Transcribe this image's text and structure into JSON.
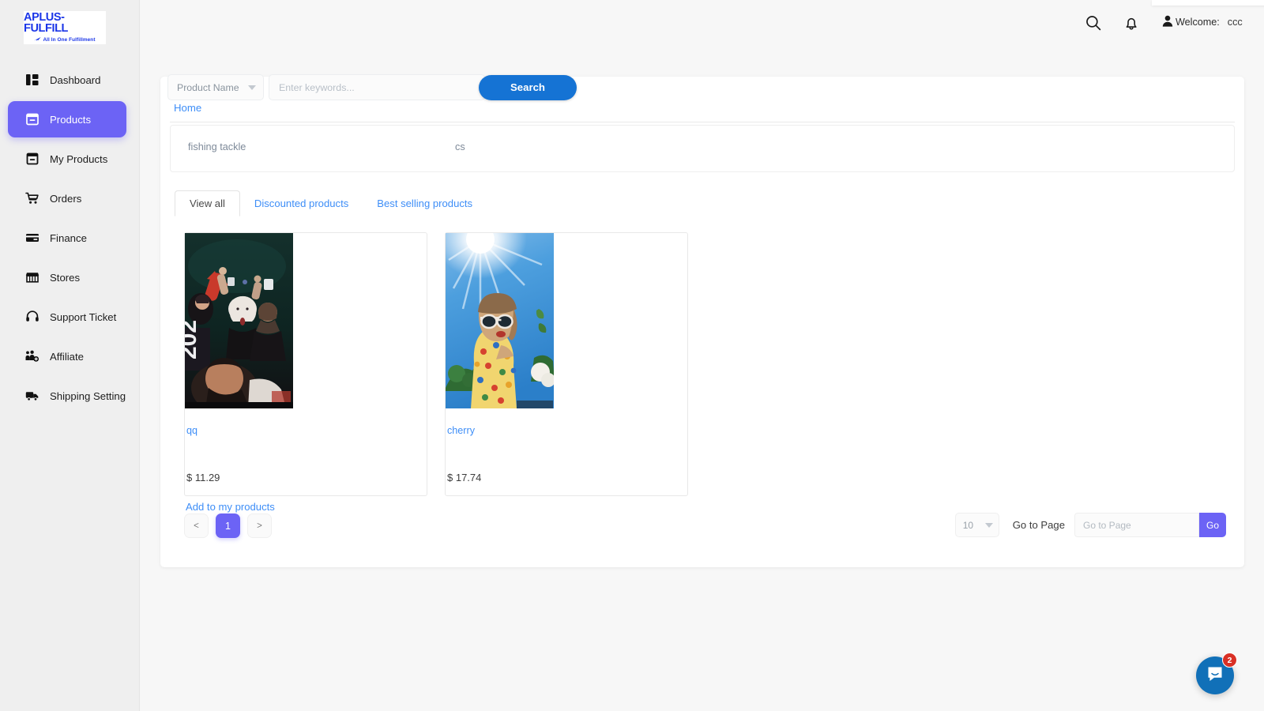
{
  "brand": {
    "logo_title": "APLUS-FULFILL",
    "logo_subtitle": "All  In One Fulfillment"
  },
  "sidebar": {
    "items": [
      {
        "label": "Dashboard",
        "icon": "dashboard-icon",
        "active": false
      },
      {
        "label": "Products",
        "icon": "products-icon",
        "active": true
      },
      {
        "label": "My Products",
        "icon": "my-products-icon",
        "active": false
      },
      {
        "label": "Orders",
        "icon": "cart-icon",
        "active": false
      },
      {
        "label": "Finance",
        "icon": "credit-card-icon",
        "active": false
      },
      {
        "label": "Stores",
        "icon": "store-icon",
        "active": false
      },
      {
        "label": "Support Ticket",
        "icon": "headset-icon",
        "active": false
      },
      {
        "label": "Affiliate",
        "icon": "affiliate-users-icon",
        "active": false
      },
      {
        "label": "Shipping Setting",
        "icon": "truck-icon",
        "active": false
      }
    ]
  },
  "topbar": {
    "search_icon": "search-icon",
    "bell_icon": "bell-icon",
    "user_icon": "user-icon",
    "welcome_label": "Welcome:",
    "username": "ccc"
  },
  "search": {
    "category_value": "Product Name",
    "keyword_value": "",
    "keyword_placeholder": "Enter keywords...",
    "button_label": "Search"
  },
  "breadcrumb": {
    "home": "Home"
  },
  "categories": [
    {
      "label": "fishing tackle"
    },
    {
      "label": "cs"
    }
  ],
  "tabs": [
    {
      "label": "View all",
      "active": true
    },
    {
      "label": "Discounted products",
      "active": false
    },
    {
      "label": "Best selling products",
      "active": false
    }
  ],
  "products": [
    {
      "title": "qq",
      "price": "$ 11.29",
      "image": "concert-crowd-photo"
    },
    {
      "title": "cherry",
      "price": "$ 17.74",
      "image": "woman-sunglasses-sky-photo"
    }
  ],
  "actions": {
    "add_to_my_products": "Add to my products"
  },
  "pagination": {
    "prev": "<",
    "next": ">",
    "current_page": "1",
    "page_size": "10",
    "goto_label": "Go to Page",
    "goto_value": "",
    "goto_placeholder": "Go to Page",
    "go_button": "Go"
  },
  "chat": {
    "badge_count": "2",
    "icon": "chat-bubble-icon"
  },
  "colors": {
    "accent_purple": "#6c63f5",
    "link_blue": "#3e8ef7",
    "search_blue": "#1573d4",
    "chat_blue": "#1170b8",
    "badge_red": "#d93025",
    "sidebar_bg": "#efefef"
  }
}
